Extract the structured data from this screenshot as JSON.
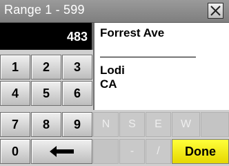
{
  "header": {
    "title": "Range 1 - 599",
    "close_icon": "close-icon"
  },
  "entry": {
    "number": "483"
  },
  "address": {
    "street": "Forrest Ave",
    "city": "Lodi",
    "state": "CA"
  },
  "keypad": {
    "rows": [
      [
        "1",
        "2",
        "3"
      ],
      [
        "4",
        "5",
        "6"
      ],
      [
        "7",
        "8",
        "9"
      ]
    ],
    "zero": "0",
    "backspace_icon": "back-arrow-icon"
  },
  "directions": [
    "N",
    "S",
    "E",
    "W"
  ],
  "bottom_keys": [
    "-",
    "/"
  ],
  "done_label": "Done"
}
